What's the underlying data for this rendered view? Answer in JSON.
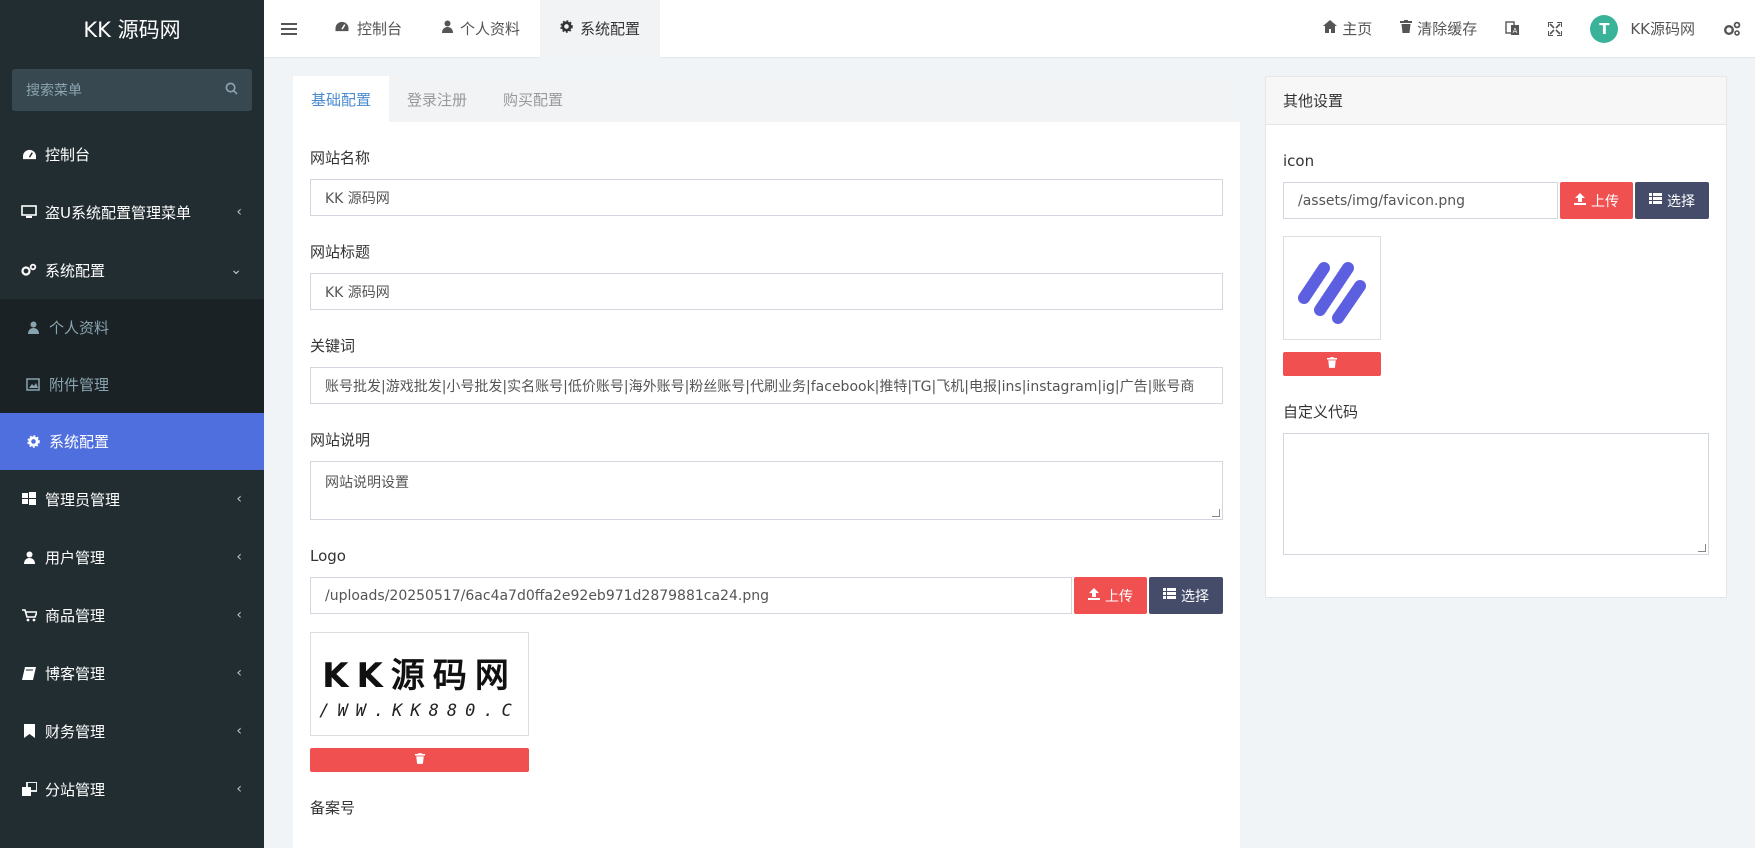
{
  "app": {
    "title": "KK 源码网"
  },
  "sidebar": {
    "search_placeholder": "搜索菜单",
    "items": [
      {
        "label": "控制台",
        "icon": "dashboard-icon"
      },
      {
        "label": "盗U系统配置管理菜单",
        "icon": "monitor-icon"
      },
      {
        "label": "系统配置",
        "icon": "gears-icon"
      }
    ],
    "sub_items": [
      {
        "label": "个人资料",
        "icon": "user-icon"
      },
      {
        "label": "附件管理",
        "icon": "image-icon"
      },
      {
        "label": "系统配置",
        "icon": "gear-icon"
      }
    ],
    "items_after": [
      {
        "label": "管理员管理",
        "icon": "windows-icon"
      },
      {
        "label": "用户管理",
        "icon": "user-icon"
      },
      {
        "label": "商品管理",
        "icon": "cart-icon"
      },
      {
        "label": "博客管理",
        "icon": "book-icon"
      },
      {
        "label": "财务管理",
        "icon": "bookmark-icon"
      },
      {
        "label": "分站管理",
        "icon": "clone-icon"
      }
    ],
    "colors": {
      "bg": "#222d32",
      "active": "#4f6fde"
    }
  },
  "topbar": {
    "tabs": [
      {
        "label": "控制台",
        "icon": "dashboard-icon"
      },
      {
        "label": "个人资料",
        "icon": "user-icon"
      },
      {
        "label": "系统配置",
        "icon": "gear-icon"
      }
    ],
    "right": {
      "home": "主页",
      "clear_cache": "清除缓存",
      "username": "KK源码网"
    }
  },
  "main": {
    "tabs": [
      "基础配置",
      "登录注册",
      "购买配置"
    ],
    "fields": {
      "site_name_label": "网站名称",
      "site_name_value": "KK 源码网",
      "site_title_label": "网站标题",
      "site_title_value": "KK 源码网",
      "keywords_label": "关键词",
      "keywords_value": "账号批发|游戏批发|小号批发|实名账号|低价账号|海外账号|粉丝账号|代刷业务|facebook|推特|TG|飞机|电报|ins|instagram|ig|广告|账号商",
      "description_label": "网站说明",
      "description_value": "网站说明设置",
      "logo_label": "Logo",
      "logo_value": "/uploads/20250517/6ac4a7d0ffa2e92eb971d2879881ca24.png",
      "logo_text_line1": "KK源码网",
      "logo_text_line2": "/WW.KK880.C",
      "icp_label": "备案号"
    },
    "buttons": {
      "upload": "上传",
      "select": "选择"
    }
  },
  "side": {
    "title": "其他设置",
    "icon_label": "icon",
    "icon_value": "/assets/img/favicon.png",
    "custom_code_label": "自定义代码",
    "custom_code_value": ""
  }
}
